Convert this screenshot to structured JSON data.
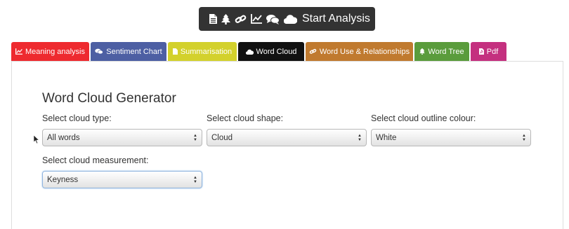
{
  "toolbar": {
    "start_label": "Start Analysis",
    "icons": [
      "document-icon",
      "tree-icon",
      "link-icon",
      "line-chart-icon",
      "comments-icon",
      "cloud-icon"
    ]
  },
  "tabs": [
    {
      "label": "Meaning analysis",
      "icon": "line-chart-icon",
      "color": "#ee2a2f"
    },
    {
      "label": "Sentiment Chart",
      "icon": "comments-icon",
      "color": "#4d5fa3"
    },
    {
      "label": "Summarisation",
      "icon": "document-icon",
      "color": "#d3d12c"
    },
    {
      "label": "Word Cloud",
      "icon": "cloud-icon",
      "color": "#111111",
      "active": true
    },
    {
      "label": "Word Use & Relationships",
      "icon": "link-icon",
      "color": "#c07a2f"
    },
    {
      "label": "Word Tree",
      "icon": "bell-icon",
      "color": "#5a9c3c"
    },
    {
      "label": "Pdf",
      "icon": "pdf-icon",
      "color": "#c4307f"
    }
  ],
  "panel": {
    "title": "Word Cloud Generator",
    "fields": {
      "cloud_type": {
        "label": "Select cloud type:",
        "value": "All words"
      },
      "cloud_shape": {
        "label": "Select cloud shape:",
        "value": "Cloud"
      },
      "outline_colour": {
        "label": "Select cloud outline colour:",
        "value": "White"
      },
      "measurement": {
        "label": "Select cloud measurement:",
        "value": "Keyness"
      }
    }
  }
}
